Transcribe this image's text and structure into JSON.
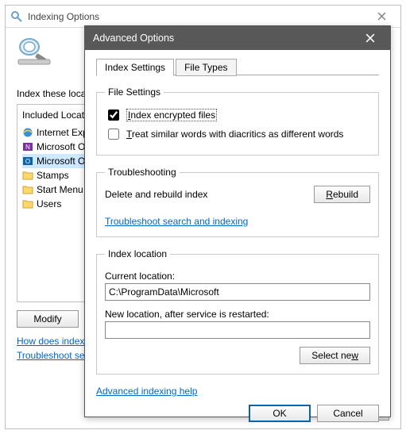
{
  "parent": {
    "title": "Indexing Options",
    "index_these_label": "Index these locations:",
    "included_title": "Included Locations",
    "items": [
      {
        "label": "Internet Explorer",
        "kind": "ie"
      },
      {
        "label": "Microsoft OneNote",
        "kind": "onenote"
      },
      {
        "label": "Microsoft Outlook",
        "kind": "outlook",
        "selected": true
      },
      {
        "label": "Stamps",
        "kind": "folder"
      },
      {
        "label": "Start Menu",
        "kind": "folder"
      },
      {
        "label": "Users",
        "kind": "folder"
      }
    ],
    "modify_label": "Modify",
    "link1": "How does indexing affect searches?",
    "link2": "Troubleshoot search and indexing",
    "close_label": "Close"
  },
  "modal": {
    "title": "Advanced Options",
    "tabs": {
      "settings": "Index Settings",
      "filetypes": "File Types"
    },
    "file_settings": {
      "legend": "File Settings",
      "encrypt_pre": "I",
      "encrypt_rest": "ndex encrypted files",
      "diacritics_pre": "T",
      "diacritics_rest": "reat similar words with diacritics as different words"
    },
    "troubleshooting": {
      "legend": "Troubleshooting",
      "delete_rebuild": "Delete and rebuild index",
      "rebuild_pre": "R",
      "rebuild_rest": "ebuild",
      "ts_link": "Troubleshoot search and indexing"
    },
    "index_location": {
      "legend": "Index location",
      "current_label": "Current location:",
      "current_value": "C:\\ProgramData\\Microsoft",
      "new_label": "New location, after service is restarted:",
      "new_value": "",
      "selectnew_pre": "Select ne",
      "selectnew_rest": "w"
    },
    "adv_help": "Advanced indexing help",
    "ok": "OK",
    "cancel": "Cancel"
  }
}
